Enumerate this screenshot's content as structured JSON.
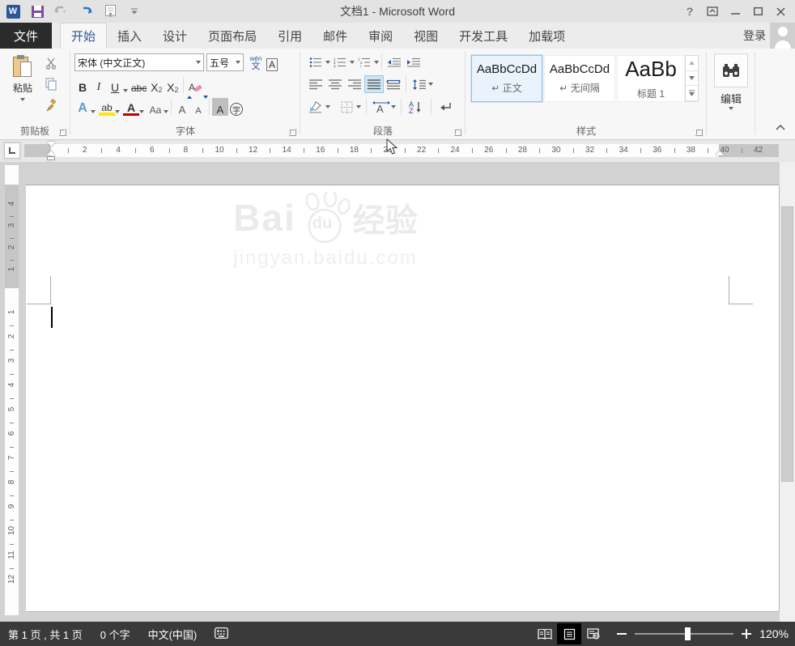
{
  "window": {
    "title": "文档1 - Microsoft Word",
    "help_glyph": "?"
  },
  "qat": {
    "icons": [
      "word-logo",
      "save-icon",
      "undo-icon",
      "redo-icon",
      "print-preview-icon",
      "customize-qat-icon"
    ]
  },
  "ribbon_tabs": [
    {
      "label": "文件"
    },
    {
      "label": "开始"
    },
    {
      "label": "插入"
    },
    {
      "label": "设计"
    },
    {
      "label": "页面布局"
    },
    {
      "label": "引用"
    },
    {
      "label": "邮件"
    },
    {
      "label": "审阅"
    },
    {
      "label": "视图"
    },
    {
      "label": "开发工具"
    },
    {
      "label": "加载项"
    }
  ],
  "account": {
    "sign_in_label": "登录"
  },
  "clipboard_group": {
    "paste_label": "粘贴",
    "group_label": "剪贴板"
  },
  "font_group": {
    "group_label": "字体",
    "font_name": "宋体 (中文正文)",
    "font_size": "五号",
    "pinyin_top": "wén",
    "pinyin_bottom": "文",
    "char_border": "A",
    "bold": "B",
    "italic": "I",
    "underline": "U",
    "strikethrough": "abc",
    "subscript_base": "X",
    "subscript_small": "2",
    "superscript_base": "X",
    "superscript_small": "2",
    "text_effects": "A",
    "highlight": "ab",
    "font_color": "A",
    "change_case": "Aa",
    "grow_font": "A",
    "shrink_font": "A",
    "char_shading": "A",
    "enclose_char": "字"
  },
  "paragraph_group": {
    "group_label": "段落",
    "sort_a": "A",
    "sort_z": "Z",
    "scale_a": "A"
  },
  "styles_group": {
    "group_label": "样式",
    "items": [
      {
        "preview": "AaBbCcDd",
        "marker": "↵",
        "name": "正文"
      },
      {
        "preview": "AaBbCcDd",
        "marker": "↵",
        "name": "无间隔"
      },
      {
        "preview": "AaBb",
        "marker": "",
        "name": "标题 1"
      }
    ]
  },
  "editing_group": {
    "group_label": "编辑",
    "button_label": "编辑"
  },
  "ruler": {
    "h_numbers": [
      2,
      4,
      6,
      8,
      10,
      12,
      14,
      16,
      18,
      20,
      22,
      24,
      26,
      28,
      30,
      32,
      34,
      36,
      38,
      40,
      42
    ],
    "v_top": [
      4,
      3,
      2,
      1
    ],
    "v_body": [
      1,
      2,
      3,
      4,
      5,
      6,
      7,
      8,
      9,
      10,
      11,
      12
    ]
  },
  "document": {
    "watermark_bai": "Bai",
    "watermark_du": "du",
    "watermark_cn": "经验",
    "watermark_url": "jingyan.baidu.com"
  },
  "status_bar": {
    "page_info": "第 1 页 , 共 1 页",
    "word_count": "0 个字",
    "language": "中文(中国)",
    "zoom_level": "120%"
  },
  "colors": {
    "accent_blue": "#2b579a",
    "file_tab_bg": "#2b2b2b",
    "save_icon_purple": "#8149a0",
    "status_bar_bg": "#3a3a3a",
    "highlight_yellow": "#ffe900",
    "font_color_red": "#c00000",
    "selection_blue": "#cde6f7"
  }
}
